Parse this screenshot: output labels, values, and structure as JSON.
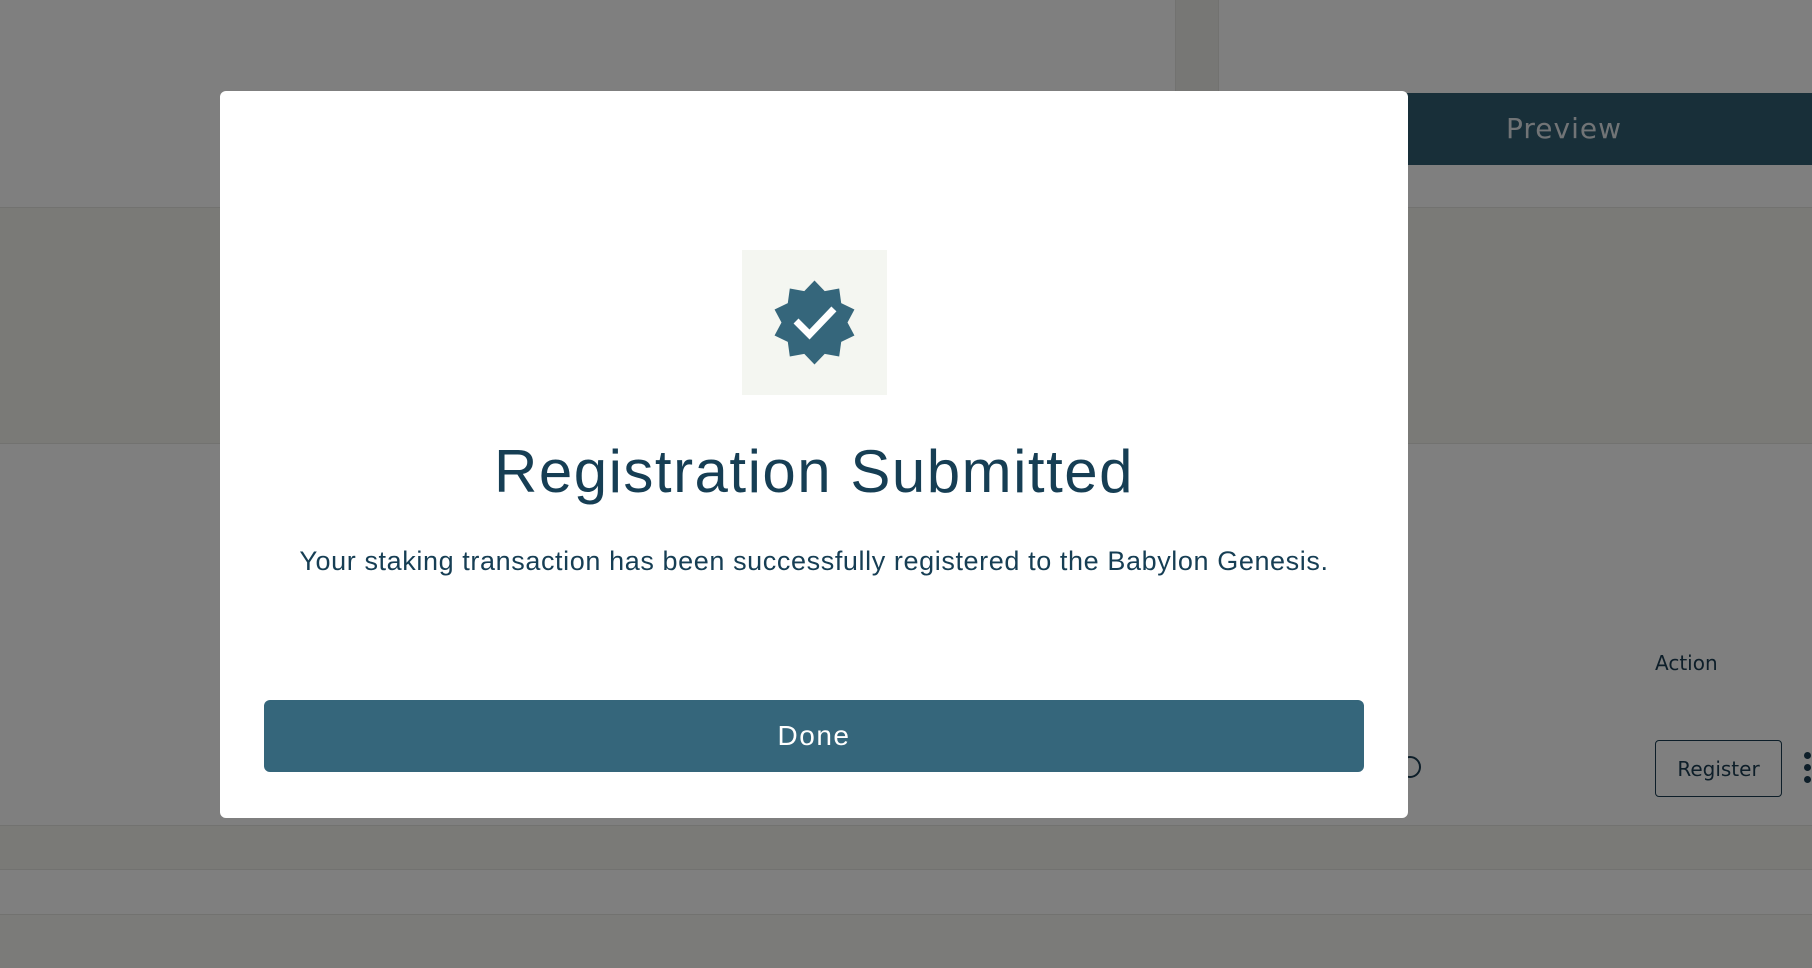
{
  "background": {
    "preview_button_label": "Preview",
    "table": {
      "action_header": "Action",
      "row": {
        "action_button_label": "Register"
      }
    }
  },
  "modal": {
    "icon": "verified-badge-icon",
    "title": "Registration Submitted",
    "message": "Your staking transaction has been successfully registered to the Babylon Genesis.",
    "done_label": "Done"
  },
  "colors": {
    "primary": "#35667b",
    "title_text": "#163e54",
    "overlay": "rgba(0,0,0,0.5)",
    "badge_bg": "#f4f6f1"
  }
}
